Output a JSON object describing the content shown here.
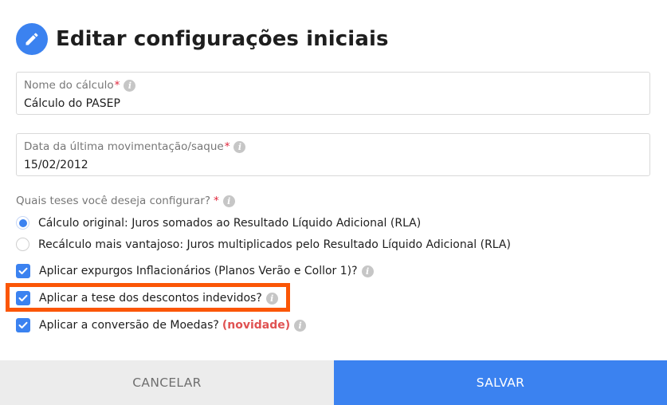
{
  "dialog": {
    "title": "Editar configurações iniciais",
    "title_icon": "pencil-icon"
  },
  "fields": {
    "calc_name": {
      "label": "Nome do cálculo",
      "required_mark": "*",
      "value": "Cálculo do PASEP"
    },
    "last_movement": {
      "label": "Data da última movimentação/saque",
      "required_mark": "*",
      "value": "15/02/2012"
    }
  },
  "theses": {
    "question": "Quais teses você deseja configurar?",
    "required_mark": "*",
    "options": [
      {
        "label": "Cálculo original: Juros somados ao Resultado Líquido Adicional (RLA)",
        "selected": true
      },
      {
        "label": "Recálculo mais vantajoso: Juros multiplicados pelo Resultado Líquido Adicional (RLA)",
        "selected": false
      }
    ]
  },
  "checks": [
    {
      "label": "Aplicar expurgos Inflacionários (Planos Verão e Collor 1)?",
      "checked": true
    },
    {
      "label": "Aplicar a tese dos descontos indevidos?",
      "checked": true
    },
    {
      "label": "Aplicar a conversão de Moedas?",
      "badge": "(novidade)",
      "checked": true
    }
  ],
  "buttons": {
    "cancel": "CANCELAR",
    "save": "SALVAR"
  },
  "info_icon_glyph": "i",
  "colors": {
    "accent": "#3b82f0",
    "highlight": "#fb5606",
    "required": "#e0253b",
    "badge": "#e05252"
  }
}
